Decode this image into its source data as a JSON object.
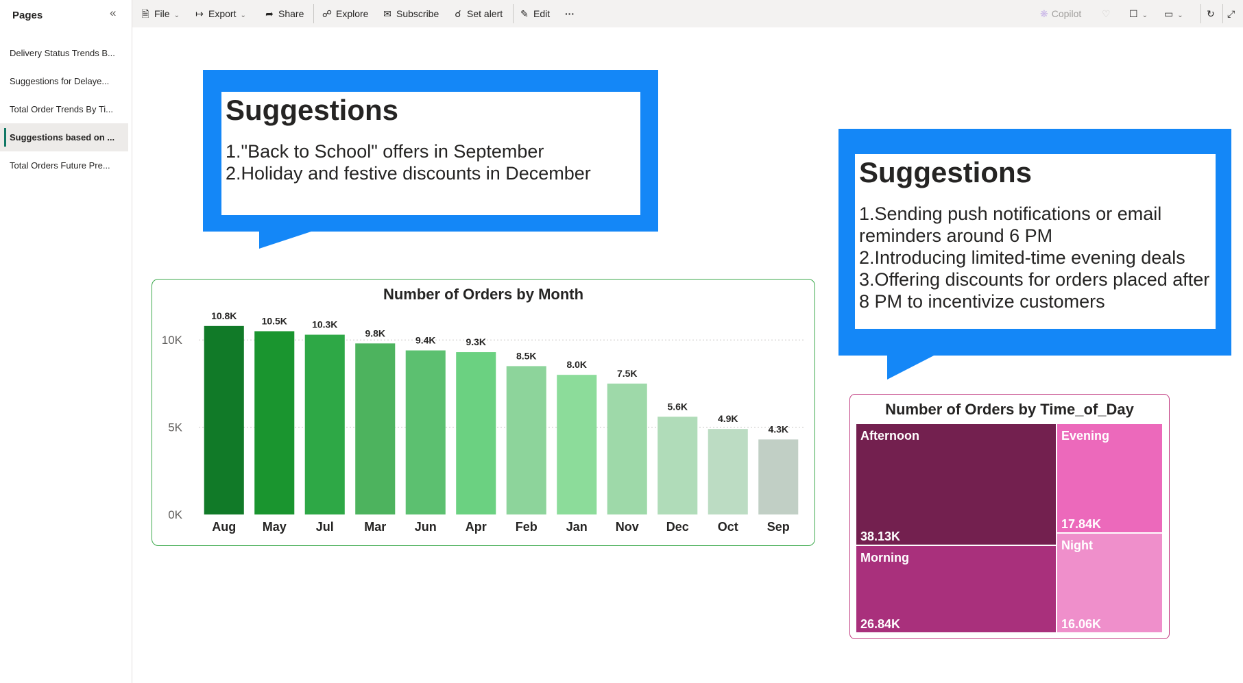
{
  "sidebar": {
    "title": "Pages",
    "items": [
      {
        "label": "Delivery Status Trends B..."
      },
      {
        "label": "Suggestions for Delaye..."
      },
      {
        "label": "Total Order Trends By Ti..."
      },
      {
        "label": "Suggestions based on ..."
      },
      {
        "label": "Total Orders Future Pre..."
      }
    ],
    "active_index": 3
  },
  "toolbar": {
    "file": "File",
    "export": "Export",
    "share": "Share",
    "explore": "Explore",
    "subscribe": "Subscribe",
    "set_alert": "Set alert",
    "edit": "Edit",
    "more": "···",
    "copilot": "Copilot"
  },
  "callout_left": {
    "title": "Suggestions",
    "lines": [
      "1.\"Back to School\" offers in September",
      "2.Holiday and festive discounts in December"
    ]
  },
  "callout_right": {
    "title": "Suggestions",
    "lines": [
      "1.Sending push notifications or email",
      "reminders around 6 PM",
      "2.Introducing limited-time evening deals",
      "3.Offering discounts for orders placed after",
      "8 PM to incentivize customers"
    ]
  },
  "colors": {
    "callout_blue": "#1487f7",
    "chart_border": "#3aa84a",
    "treemap_border": "#c0397f"
  },
  "chart_data": [
    {
      "type": "bar",
      "title": "Number of Orders by Month",
      "categories": [
        "Aug",
        "May",
        "Jul",
        "Mar",
        "Jun",
        "Apr",
        "Feb",
        "Jan",
        "Nov",
        "Dec",
        "Oct",
        "Sep"
      ],
      "values": [
        10800,
        10500,
        10300,
        9800,
        9400,
        9300,
        8500,
        8000,
        7500,
        5600,
        4900,
        4300
      ],
      "data_labels": [
        "10.8K",
        "10.5K",
        "10.3K",
        "9.8K",
        "9.4K",
        "9.3K",
        "8.5K",
        "8.0K",
        "7.5K",
        "5.6K",
        "4.9K",
        "4.3K"
      ],
      "bar_colors": [
        "#117a28",
        "#1a952f",
        "#2ea846",
        "#4db35e",
        "#5cc070",
        "#6bd181",
        "#8dd49b",
        "#8cdc9a",
        "#9ed9a9",
        "#b0dcb9",
        "#bcdcc3",
        "#c1cfc5"
      ],
      "yticks": [
        "0K",
        "5K",
        "10K"
      ],
      "ytick_values": [
        0,
        5000,
        10000
      ],
      "ylim": [
        0,
        11500
      ],
      "xlabel": "",
      "ylabel": "",
      "grid": true
    },
    {
      "type": "treemap",
      "title": "Number of Orders by Time_of_Day",
      "items": [
        {
          "label": "Afternoon",
          "value_label": "38.13K",
          "value": 38130,
          "color": "#73204f"
        },
        {
          "label": "Morning",
          "value_label": "26.84K",
          "value": 26840,
          "color": "#a9307c"
        },
        {
          "label": "Evening",
          "value_label": "17.84K",
          "value": 17840,
          "color": "#ec69bb"
        },
        {
          "label": "Night",
          "value_label": "16.06K",
          "value": 16060,
          "color": "#ef8fcb"
        }
      ]
    }
  ]
}
